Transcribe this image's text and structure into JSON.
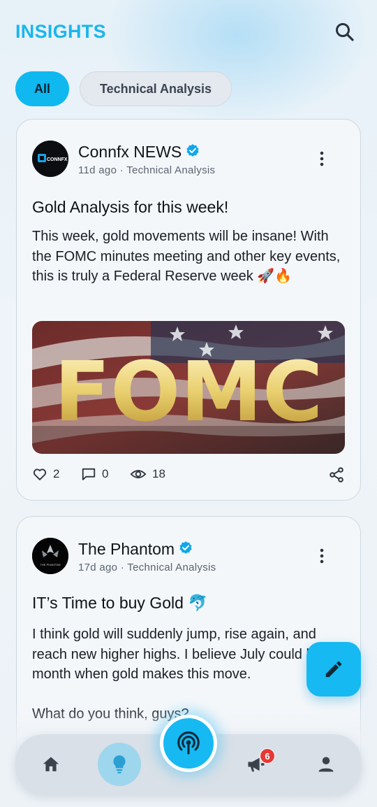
{
  "header": {
    "title": "INSIGHTS"
  },
  "filters": [
    {
      "label": "All",
      "active": true
    },
    {
      "label": "Technical Analysis",
      "active": false
    }
  ],
  "posts": [
    {
      "author": "Connfx NEWS",
      "verified": true,
      "avatar_text": "CONNFX",
      "time": "11d ago",
      "category": "Technical Analysis",
      "title": "Gold Analysis for this week!",
      "body": "This week, gold movements will be insane! With the FOMC minutes meeting and other key events, this is truly a Federal Reserve week 🚀🔥",
      "image_text": "FOMC",
      "likes": "2",
      "comments": "0",
      "views": "18"
    },
    {
      "author": "The Phantom",
      "verified": true,
      "avatar_text": "THE PHANTOM",
      "time": "17d ago",
      "category": "Technical Analysis",
      "title": "IT’s Time to buy Gold 🐬",
      "body": "I think gold will suddenly jump, rise again, and reach new higher highs. I believe July could be the month when gold makes this move.\n\nWhat do you think, guys?"
    }
  ],
  "nav": {
    "notifications_badge": "6"
  },
  "colors": {
    "accent": "#16b9f2",
    "title": "#1ab6ec",
    "badge": "#e53935"
  }
}
